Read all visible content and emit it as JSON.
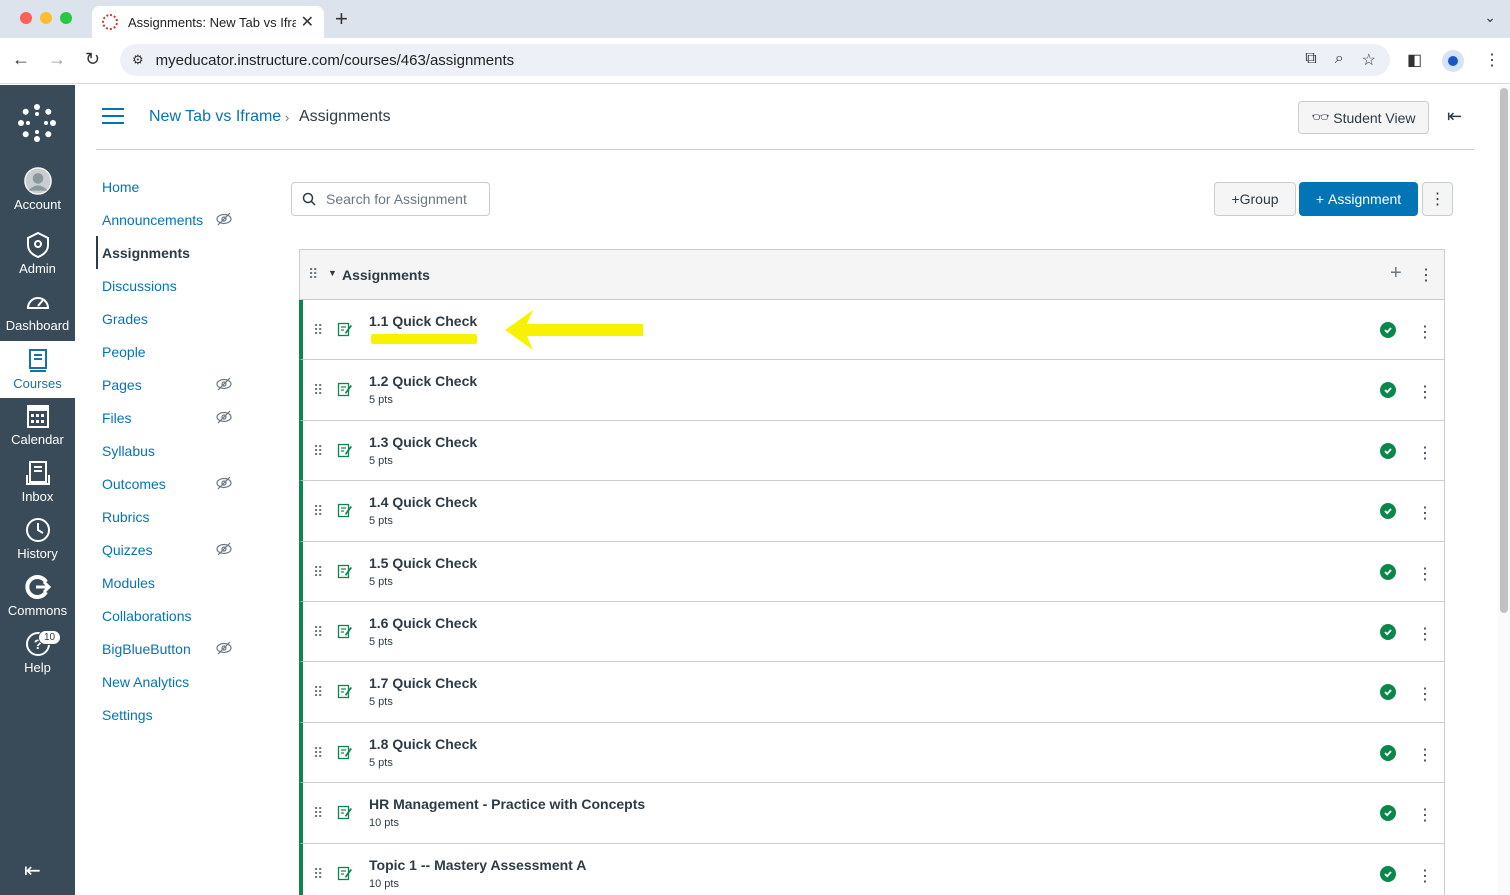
{
  "browser": {
    "tab_title": "Assignments: New Tab vs Ifra",
    "url": "myeducator.instructure.com/courses/463/assignments"
  },
  "global_nav": {
    "items": [
      {
        "label": "Account",
        "icon": "account-avatar-icon"
      },
      {
        "label": "Admin",
        "icon": "admin-shield-icon"
      },
      {
        "label": "Dashboard",
        "icon": "dashboard-gauge-icon"
      },
      {
        "label": "Courses",
        "icon": "courses-book-icon",
        "active": true
      },
      {
        "label": "Calendar",
        "icon": "calendar-icon"
      },
      {
        "label": "Inbox",
        "icon": "inbox-icon"
      },
      {
        "label": "History",
        "icon": "clock-icon"
      },
      {
        "label": "Commons",
        "icon": "commons-icon"
      },
      {
        "label": "Help",
        "icon": "help-icon",
        "badge": "10"
      }
    ]
  },
  "header": {
    "breadcrumb_course": "New Tab vs Iframe",
    "breadcrumb_separator": "›",
    "breadcrumb_current": "Assignments",
    "student_view_label": "Student View"
  },
  "course_nav": {
    "items": [
      {
        "label": "Home",
        "hidden": false
      },
      {
        "label": "Announcements",
        "hidden": true
      },
      {
        "label": "Assignments",
        "hidden": false,
        "active": true
      },
      {
        "label": "Discussions",
        "hidden": false
      },
      {
        "label": "Grades",
        "hidden": false
      },
      {
        "label": "People",
        "hidden": false
      },
      {
        "label": "Pages",
        "hidden": true
      },
      {
        "label": "Files",
        "hidden": true
      },
      {
        "label": "Syllabus",
        "hidden": false
      },
      {
        "label": "Outcomes",
        "hidden": true
      },
      {
        "label": "Rubrics",
        "hidden": false
      },
      {
        "label": "Quizzes",
        "hidden": true
      },
      {
        "label": "Modules",
        "hidden": false
      },
      {
        "label": "Collaborations",
        "hidden": false
      },
      {
        "label": "BigBlueButton",
        "hidden": true
      },
      {
        "label": "New Analytics",
        "hidden": false
      },
      {
        "label": "Settings",
        "hidden": false
      }
    ]
  },
  "toolbar": {
    "search_placeholder": "Search for Assignment",
    "group_button": "Group",
    "assignment_button": "Assignment"
  },
  "assignment_group": {
    "title": "Assignments",
    "assignments": [
      {
        "title": "1.1 Quick Check",
        "points": "",
        "published": true,
        "highlighted": true
      },
      {
        "title": "1.2 Quick Check",
        "points": "5 pts",
        "published": true
      },
      {
        "title": "1.3 Quick Check",
        "points": "5 pts",
        "published": true
      },
      {
        "title": "1.4 Quick Check",
        "points": "5 pts",
        "published": true
      },
      {
        "title": "1.5 Quick Check",
        "points": "5 pts",
        "published": true
      },
      {
        "title": "1.6 Quick Check",
        "points": "5 pts",
        "published": true
      },
      {
        "title": "1.7 Quick Check",
        "points": "5 pts",
        "published": true
      },
      {
        "title": "1.8 Quick Check",
        "points": "5 pts",
        "published": true
      },
      {
        "title": "HR Management - Practice with Concepts",
        "points": "10 pts",
        "published": true
      },
      {
        "title": "Topic 1 -- Mastery Assessment A",
        "points": "10 pts",
        "published": true
      }
    ]
  },
  "colors": {
    "nav_bg": "#394b58",
    "link": "#0374b5",
    "published": "#0b874b",
    "annotation": "#f7f300"
  }
}
